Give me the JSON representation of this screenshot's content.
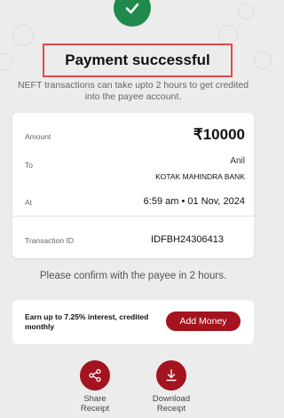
{
  "status": {
    "title": "Payment successful",
    "subtitle": "NEFT transactions can take upto 2 hours to get credited into the payee account."
  },
  "details": {
    "amount_label": "Amount",
    "amount_value": "₹10000",
    "to_label": "To",
    "payee_name": "Anil",
    "payee_bank": "KOTAK MAHINDRA BANK",
    "at_label": "At",
    "datetime": "6:59 am • 01 Nov, 2024",
    "txn_label": "Transaction ID",
    "txn_value": "IDFBH24306413"
  },
  "confirm_text": "Please confirm with the payee in 2 hours.",
  "promo": {
    "text": "Earn up to 7.25% interest, credited monthly",
    "button_label": "Add Money"
  },
  "actions": {
    "share_line1": "Share",
    "share_line2": "Receipt",
    "download_line1": "Download",
    "download_line2": "Receipt"
  },
  "colors": {
    "success_green": "#1f8a4c",
    "brand_maroon": "#a3141f",
    "highlight_red": "#e6474b",
    "background": "#ececec"
  },
  "icons": [
    "check-icon",
    "share-icon",
    "download-icon"
  ]
}
